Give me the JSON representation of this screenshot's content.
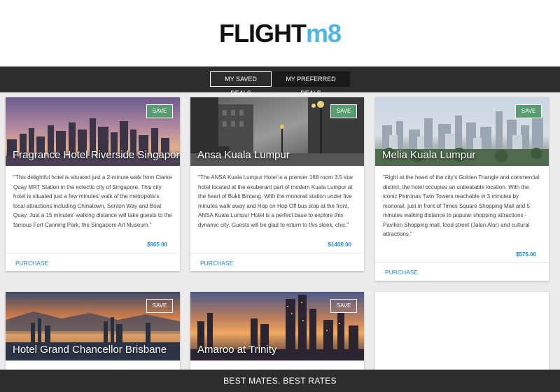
{
  "logo": {
    "part1": "FLIGHT",
    "part2": "m8"
  },
  "tabs": {
    "saved": "MY SAVED DEALS",
    "preferred": "MY PREFERRED DEALS"
  },
  "deals": [
    {
      "title": "Fragrance Hotel Riverside Singapore",
      "save_label": "SAVE",
      "description": "\"This delightful hotel is situated just a 2-minute walk from Clarke Quay MRT Station in the eclectic city of Singapore. This city hotel is situated just a few minutes' walk of the metropolis's local attractions including Chinatown, Senton Way and Boat Quay. Just a 15 minutes' walking distance will take guests to the famous Fort Canning Park, the Singapore Art Museum.\"",
      "price": "$965.00",
      "purchase_label": "PURCHASE"
    },
    {
      "title": "Ansa Kuala Lumpur",
      "save_label": "SAVE",
      "description": "\"The ANSA Kuala Lumpur Hotel is a premier 168 room 3.5 star hotel located at the exuberant part of modern Kuala Lumpur at the heart of Bukit Bintang. With the monorail station under five minutes walk away and Hop on Hop Off bus stop at the front, ANSA Kuala Lumpur Hotel is a perfect base to explore this dynamic city. Guests will be glad to return to this sleek, chic.\"",
      "price": "$1400.00",
      "purchase_label": "PURCHASE"
    },
    {
      "title": "Melia Kuala Lumpur",
      "save_label": "SAVE",
      "description": "\"Right at the heart of the city's Golden Triangle and commercial district, the hotel occupies an unbeatable location. With the iconic Petronas Twin Towers reachable in 3 minutes by monorail, just in front of Times Square Shopping Mall and 5 minutes walking distance to popular shopping attractions - Pavilion Shopping mall, food street (Jalan Alor) and cultural attractions.\"",
      "price": "$575.00",
      "purchase_label": "PURCHASE"
    },
    {
      "title": "Hotel Grand Chancellor Brisbane",
      "save_label": "SAVE"
    },
    {
      "title": "Amaroo at Trinity",
      "save_label": "SAVE"
    }
  ],
  "footer": {
    "tagline": "BEST MATES. BEST RATES"
  },
  "colors": {
    "accent": "#1e88e5",
    "save_active": "#5a9c72",
    "dark_bar": "#2d2d2d",
    "logo_accent": "#4fb5e3"
  },
  "icons": []
}
